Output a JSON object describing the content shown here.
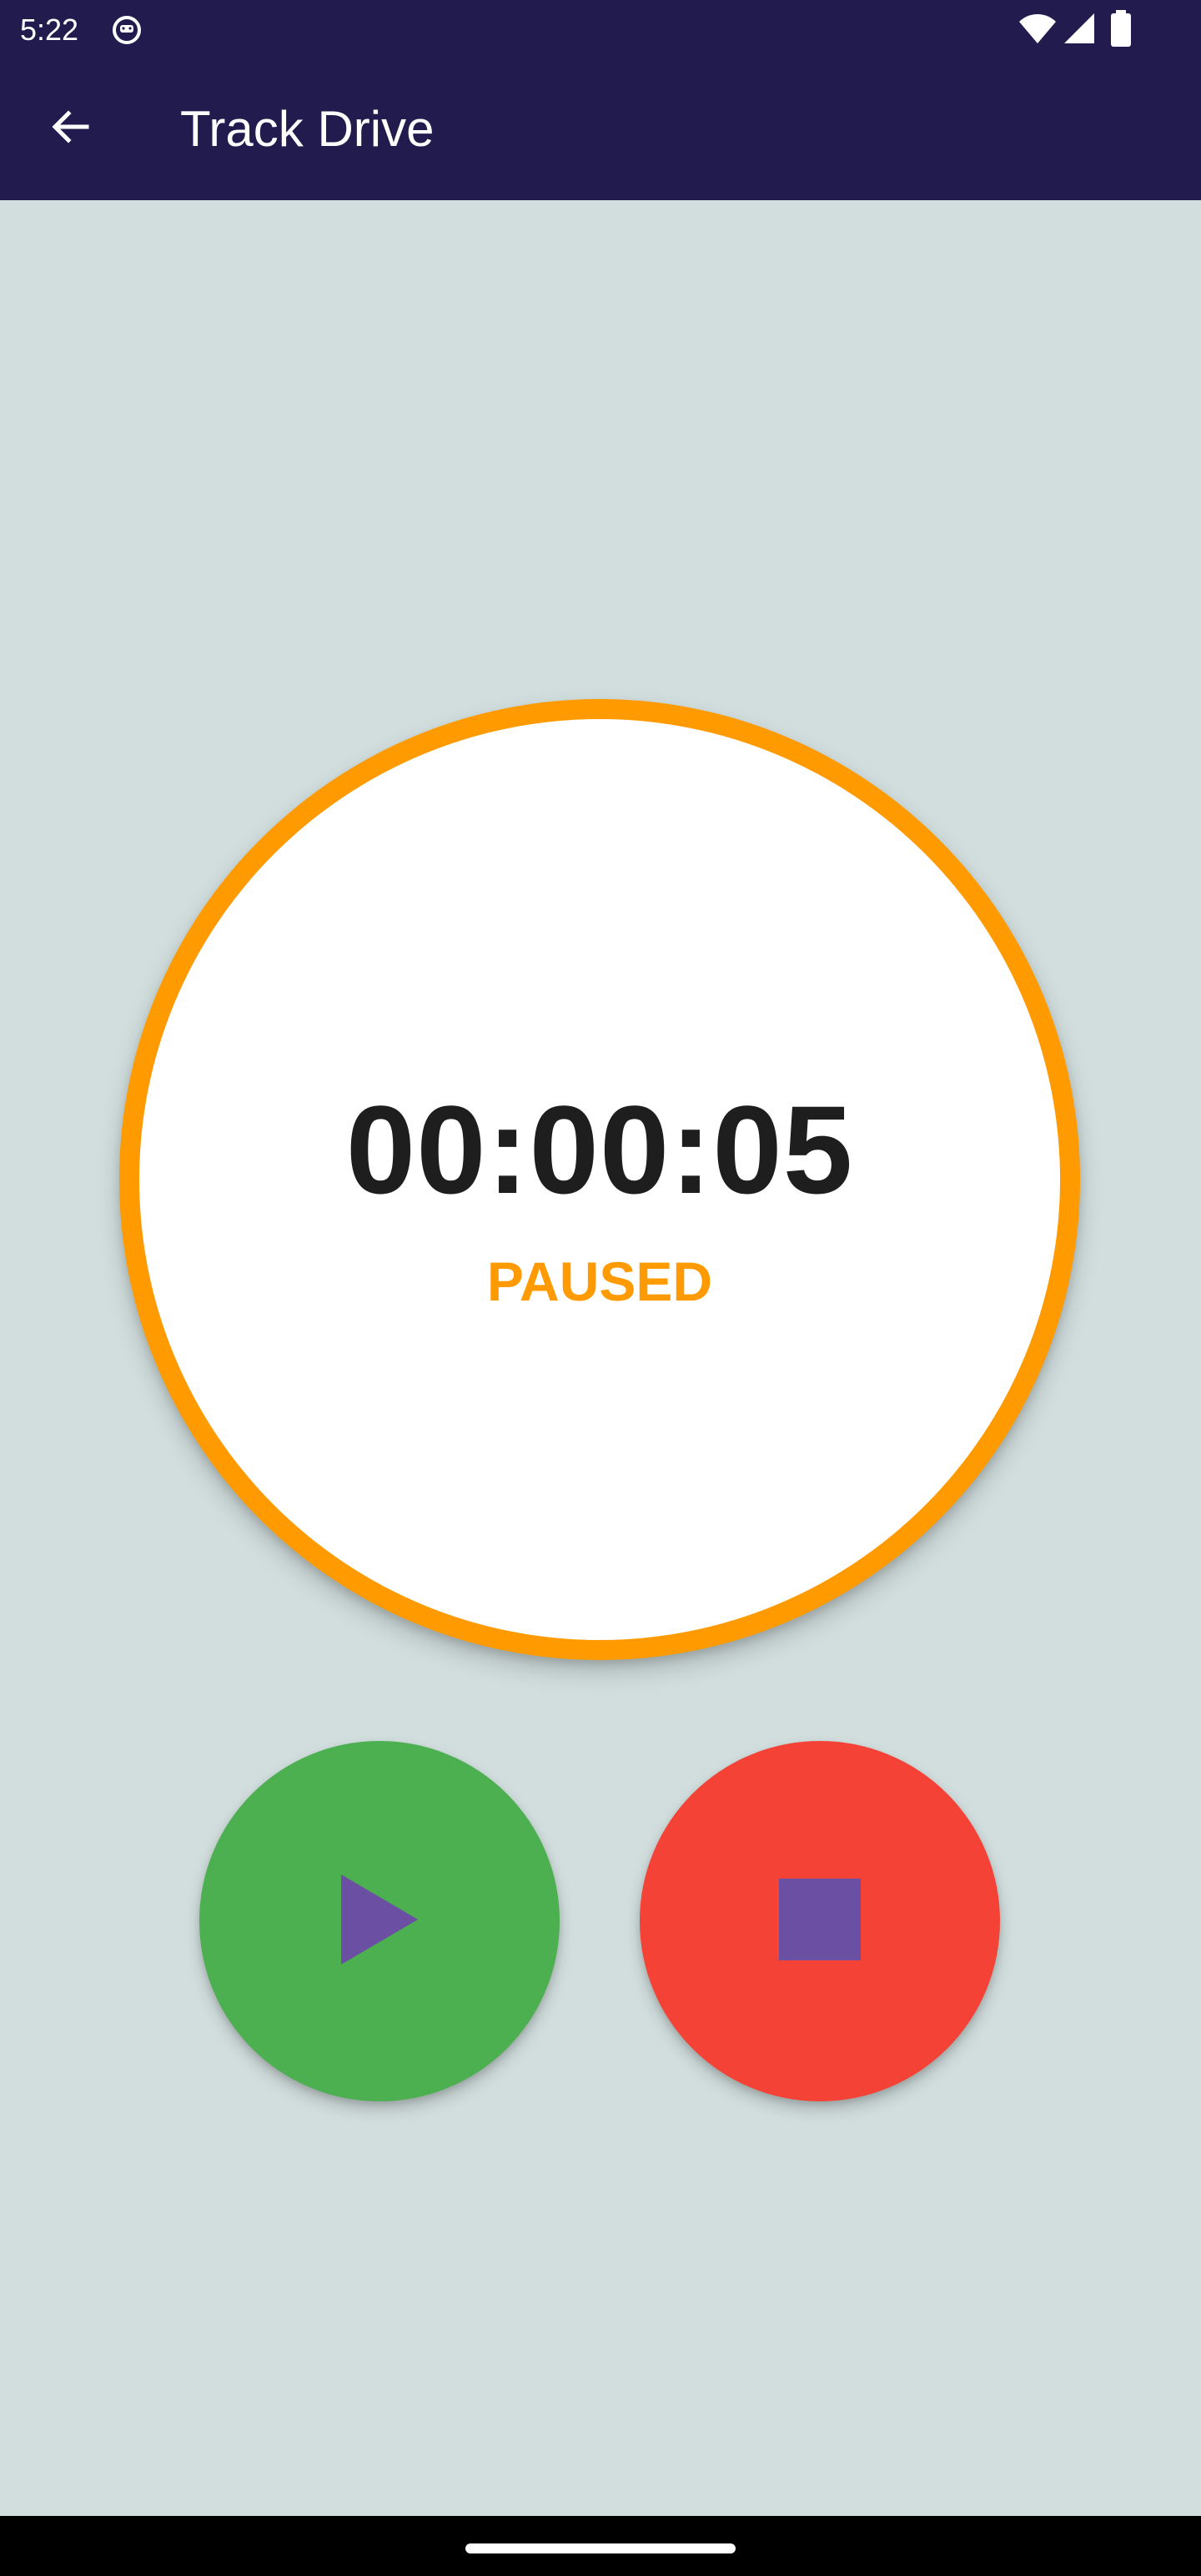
{
  "status_bar": {
    "time": "5:22",
    "icons": [
      "notification-icon",
      "wifi-icon",
      "signal-icon",
      "battery-icon"
    ]
  },
  "app_bar": {
    "title": "Track Drive",
    "back_icon": "arrow-back-icon"
  },
  "timer": {
    "elapsed": "00:00:05",
    "status": "PAUSED"
  },
  "controls": {
    "play_icon": "play-icon",
    "stop_icon": "stop-icon"
  },
  "colors": {
    "app_bar_bg": "#211b4e",
    "page_bg": "#d1dedd",
    "timer_ring": "#ff9a00",
    "status_text": "#ff9a00",
    "play_button": "#4caf50",
    "stop_button": "#f44336",
    "control_icon": "#6a4fa3"
  }
}
